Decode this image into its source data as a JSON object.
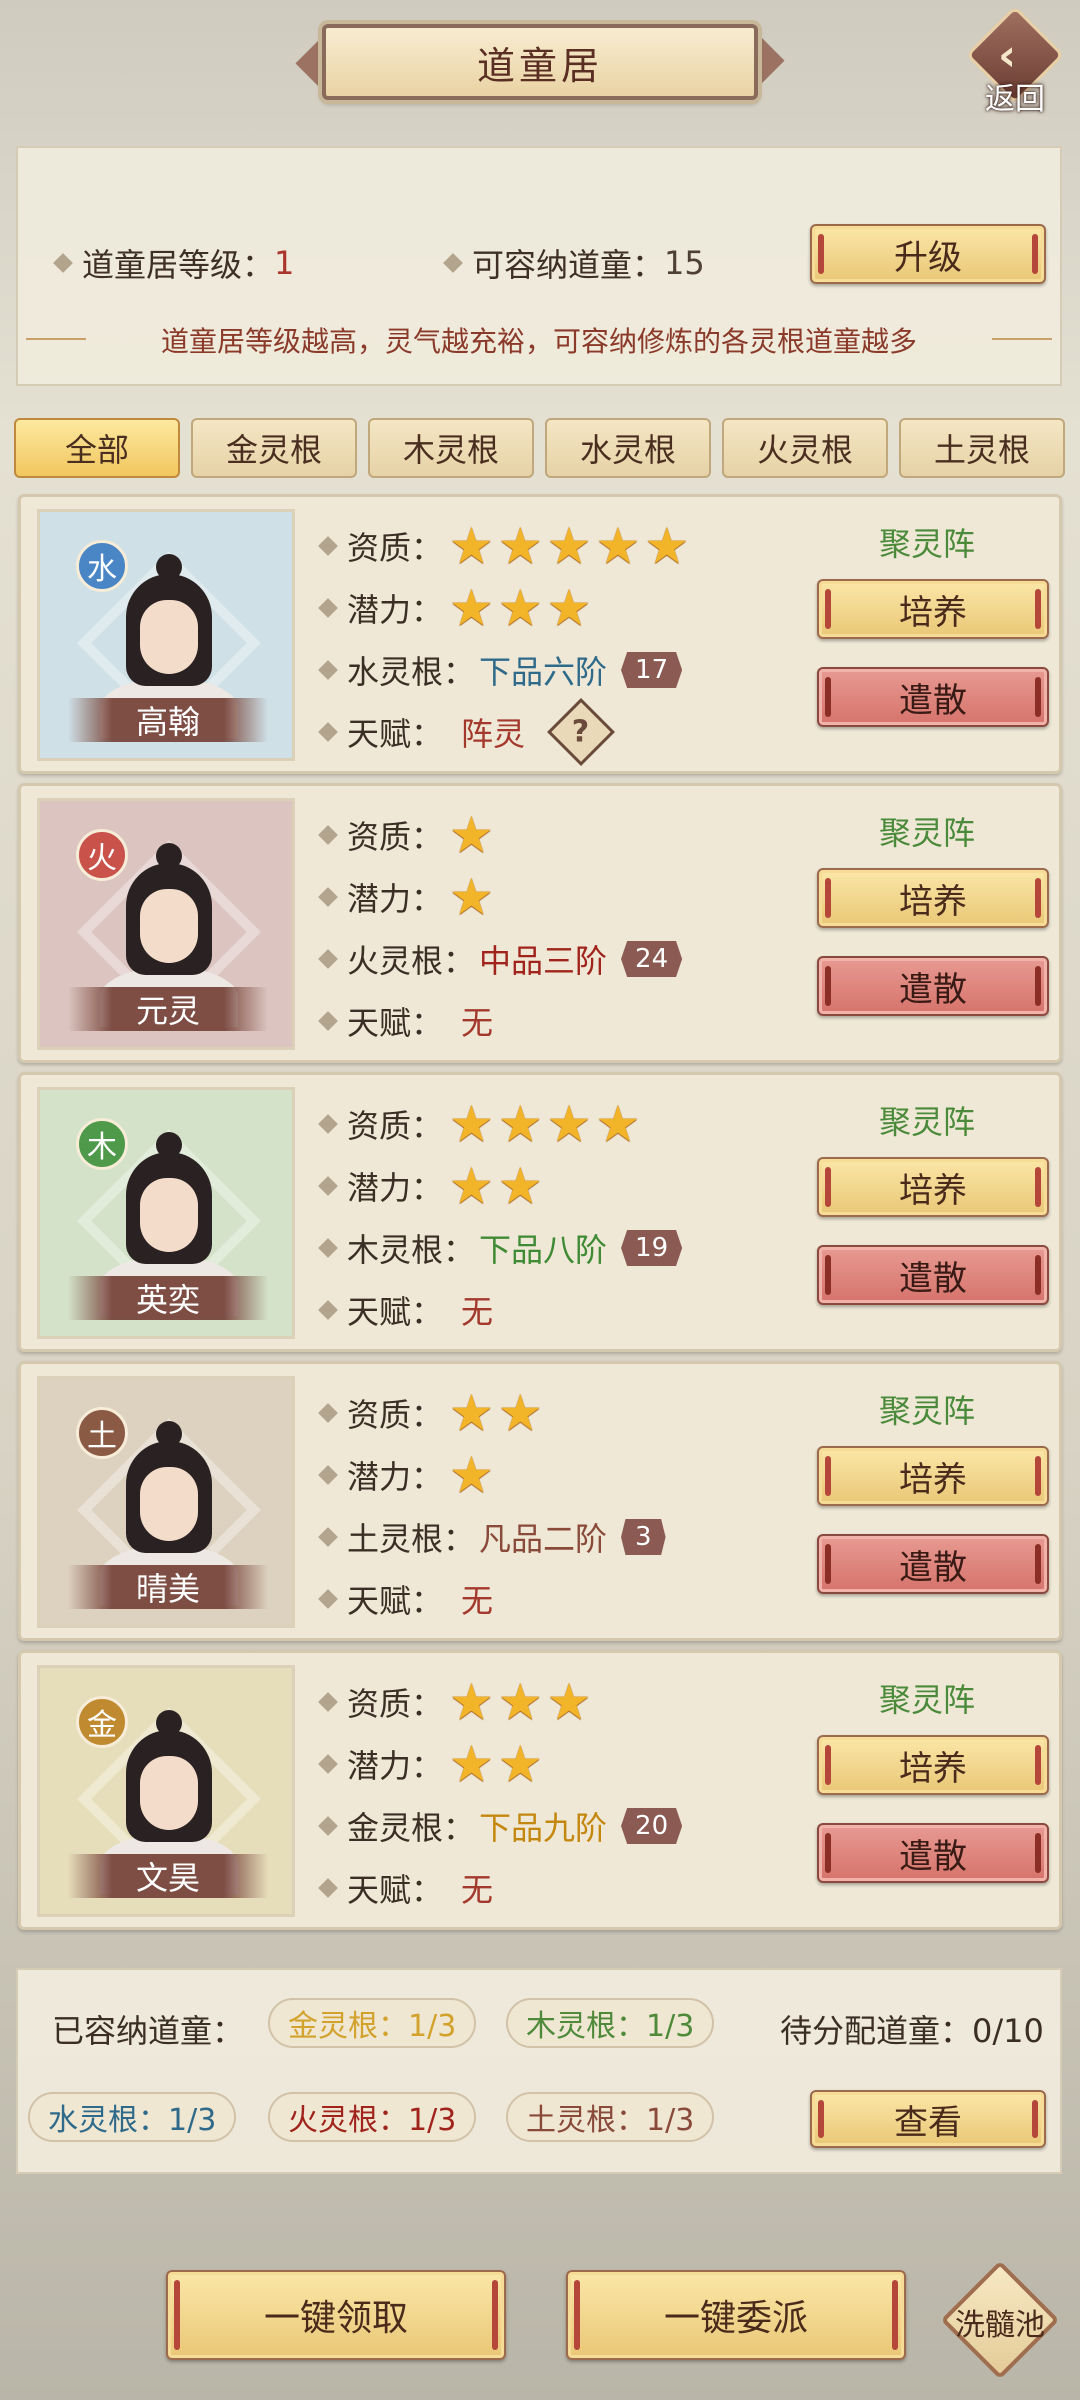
{
  "header": {
    "title": "道童居",
    "back_label": "返回"
  },
  "info": {
    "level_label": "道童居等级：",
    "level_value": "1",
    "capacity_label": "可容纳道童：",
    "capacity_value": "15",
    "upgrade_label": "升级",
    "hint": "道童居等级越高，灵气越充裕，可容纳修炼的各灵根道童越多"
  },
  "tabs": [
    "全部",
    "金灵根",
    "木灵根",
    "水灵根",
    "火灵根",
    "土灵根"
  ],
  "cards": [
    {
      "element": "水",
      "element_color": "#4a86c5",
      "bg_color": "#cfe0e6",
      "name": "高翰",
      "aptitude_label": "资质：",
      "aptitude_stars": 5,
      "potential_label": "潜力：",
      "potential_stars": 3,
      "root_label": "水灵根：",
      "root_grade": "下品六阶",
      "root_color": "#2f6a8a",
      "root_level": "17",
      "talent_label": "天赋：",
      "talent": "阵灵",
      "talent_help": "?",
      "formation": "聚灵阵",
      "train": "培养",
      "dismiss": "遣散"
    },
    {
      "element": "火",
      "element_color": "#c9524a",
      "bg_color": "#dcc5c0",
      "name": "元灵",
      "aptitude_label": "资质：",
      "aptitude_stars": 1,
      "potential_label": "潜力：",
      "potential_stars": 1,
      "root_label": "火灵根：",
      "root_grade": "中品三阶",
      "root_color": "#a0231c",
      "root_level": "24",
      "talent_label": "天赋：",
      "talent": "无",
      "formation": "聚灵阵",
      "train": "培养",
      "dismiss": "遣散"
    },
    {
      "element": "木",
      "element_color": "#4e9a4a",
      "bg_color": "#d3e2c8",
      "name": "英奕",
      "aptitude_label": "资质：",
      "aptitude_stars": 4,
      "potential_label": "潜力：",
      "potential_stars": 2,
      "root_label": "木灵根：",
      "root_grade": "下品八阶",
      "root_color": "#3f8a34",
      "root_level": "19",
      "talent_label": "天赋：",
      "talent": "无",
      "formation": "聚灵阵",
      "train": "培养",
      "dismiss": "遣散"
    },
    {
      "element": "土",
      "element_color": "#8a5a44",
      "bg_color": "#ddd2bf",
      "name": "晴美",
      "aptitude_label": "资质：",
      "aptitude_stars": 2,
      "potential_label": "潜力：",
      "potential_stars": 1,
      "root_label": "土灵根：",
      "root_grade": "凡品二阶",
      "root_color": "#8a4a3a",
      "root_level": "3",
      "talent_label": "天赋：",
      "talent": "无",
      "formation": "聚灵阵",
      "train": "培养",
      "dismiss": "遣散"
    },
    {
      "element": "金",
      "element_color": "#c08a30",
      "bg_color": "#e6ddba",
      "name": "文昊",
      "aptitude_label": "资质：",
      "aptitude_stars": 3,
      "potential_label": "潜力：",
      "potential_stars": 2,
      "root_label": "金灵根：",
      "root_grade": "下品九阶",
      "root_color": "#c4870e",
      "root_level": "20",
      "talent_label": "天赋：",
      "talent": "无",
      "formation": "聚灵阵",
      "train": "培养",
      "dismiss": "遣散"
    }
  ],
  "summary": {
    "label": "已容纳道童：",
    "pending": "待分配道童：0/10",
    "pills": [
      {
        "text": "金灵根：1/3",
        "color": "#d2a22c"
      },
      {
        "text": "木灵根：1/3",
        "color": "#4f8a3a"
      },
      {
        "text": "水灵根：1/3",
        "color": "#2f6a8a"
      },
      {
        "text": "火灵根：1/3",
        "color": "#a0231c"
      },
      {
        "text": "土灵根：1/3",
        "color": "#8a4a3a"
      }
    ],
    "view_label": "查看"
  },
  "bottom": {
    "claim_all": "一键领取",
    "assign_all": "一键委派",
    "pool": "洗髓池"
  }
}
